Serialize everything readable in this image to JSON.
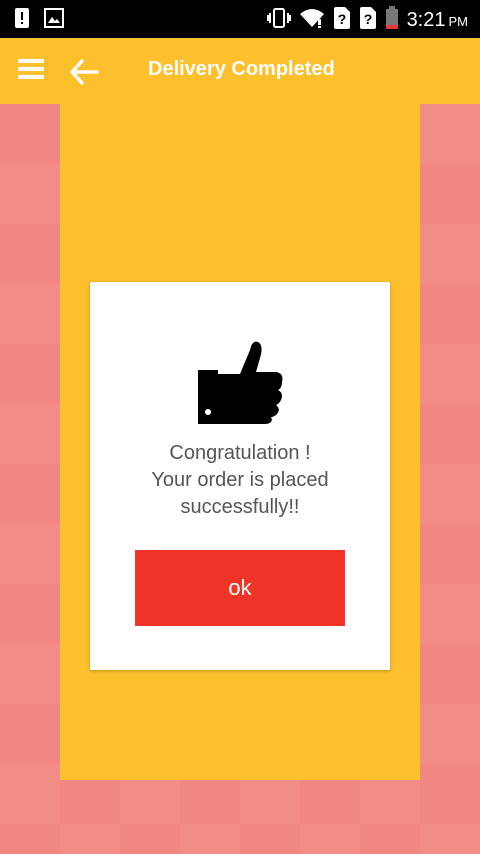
{
  "status_bar": {
    "time": "3:21",
    "ampm": "PM",
    "icons": [
      "alert-icon",
      "image-icon",
      "vibrate-icon",
      "wifi-icon",
      "unknown-sim-icon",
      "unknown-sim-icon",
      "battery-icon"
    ]
  },
  "app_bar": {
    "title": "Delivery Completed",
    "menu_icon": "menu-icon",
    "back_icon": "back-arrow-icon",
    "color": "#fcc02d"
  },
  "dialog": {
    "icon": "thumbs-up-icon",
    "message_line1": "Congratulation !",
    "message_line2": "Your order is placed",
    "message_line3": "successfully!!",
    "ok_label": "ok",
    "ok_color": "#ef3326"
  }
}
